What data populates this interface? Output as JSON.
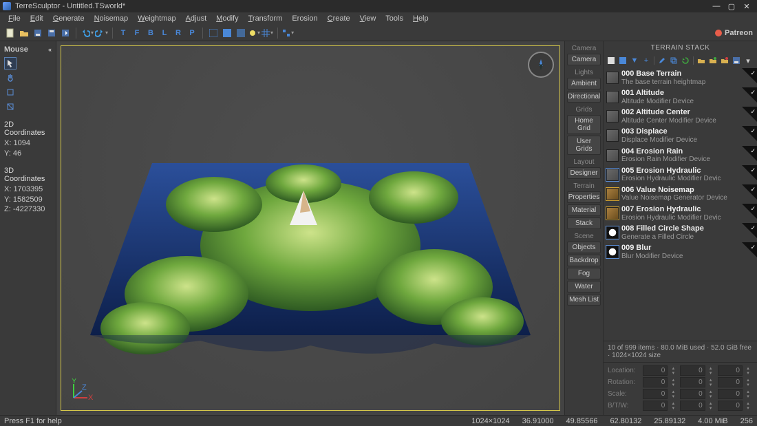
{
  "title": "TerreSculptor - Untitled.TSworld*",
  "window": {
    "min": "—",
    "max": "▢",
    "close": "✕"
  },
  "menus": [
    {
      "u": "F",
      "r": "ile"
    },
    {
      "u": "E",
      "r": "dit"
    },
    {
      "u": "G",
      "r": "enerate"
    },
    {
      "u": "N",
      "r": "oisemap"
    },
    {
      "u": "W",
      "r": "eightmap"
    },
    {
      "u": "A",
      "r": "djust"
    },
    {
      "u": "M",
      "r": "odify"
    },
    {
      "u": "T",
      "r": "ransform"
    },
    {
      "u": "",
      "r": "Erosion"
    },
    {
      "u": "C",
      "r": "reate"
    },
    {
      "u": "V",
      "r": "iew"
    },
    {
      "u": "",
      "r": "Tools"
    },
    {
      "u": "H",
      "r": "elp"
    }
  ],
  "patreon_label": "Patreon",
  "left": {
    "panel_title": "Mouse",
    "coords2d_title": "2D Coordinates",
    "coords2d": {
      "x_label": "X:",
      "x": "1094",
      "y_label": "Y:",
      "y": "46"
    },
    "coords3d_title": "3D Coordinates",
    "coords3d": {
      "x_label": "X:",
      "x": "1703395",
      "y_label": "Y:",
      "y": "1582509",
      "z_label": "Z:",
      "z": "-4227330"
    }
  },
  "categories": [
    {
      "head": "Camera",
      "items": [
        "Camera"
      ]
    },
    {
      "head": "Lights",
      "items": [
        "Ambient",
        "Directional"
      ]
    },
    {
      "head": "Grids",
      "items": [
        "Home Grid",
        "User Grids"
      ]
    },
    {
      "head": "Layout",
      "items": [
        "Designer"
      ]
    },
    {
      "head": "Terrain",
      "items": [
        "Properties",
        "Material",
        "Stack"
      ]
    },
    {
      "head": "Scene",
      "items": [
        "Objects",
        "Backdrop",
        "Fog",
        "Water",
        "Mesh List"
      ]
    }
  ],
  "stack": {
    "title": "TERRAIN STACK",
    "items": [
      {
        "name": "000 Base Terrain",
        "desc": "The base terrain heightmap",
        "thumb": "gray",
        "sel": false
      },
      {
        "name": "001 Altitude",
        "desc": "Altitude Modifier Device",
        "thumb": "gray",
        "sel": false
      },
      {
        "name": "002 Altitude Center",
        "desc": "Altitude Center Modifier Device",
        "thumb": "gray",
        "sel": false
      },
      {
        "name": "003 Displace",
        "desc": "Displace Modifier Device",
        "thumb": "gray",
        "sel": false
      },
      {
        "name": "004 Erosion Rain",
        "desc": "Erosion Rain Modifier Device",
        "thumb": "gray",
        "sel": false
      },
      {
        "name": "005 Erosion Hydraulic",
        "desc": "Erosion Hydraulic Modifier Devic",
        "thumb": "gray",
        "sel": true
      },
      {
        "name": "006 Value Noisemap",
        "desc": "Value Noisemap Generator Device",
        "thumb": "brown",
        "gold": true
      },
      {
        "name": "007 Erosion Hydraulic",
        "desc": "Erosion Hydraulic Modifier Devic",
        "thumb": "brown",
        "gold": true
      },
      {
        "name": "008 Filled Circle Shape",
        "desc": "Generate a Filled Circle",
        "thumb": "circle",
        "sel": true
      },
      {
        "name": "009 Blur",
        "desc": "Blur Modifier Device",
        "thumb": "circle",
        "sel": true
      }
    ],
    "status": "10 of 999 items · 80.0 MiB used · 52.0 GiB free · 1024×1024 size",
    "transform": {
      "rows": [
        "Location:",
        "Rotation:",
        "Scale:",
        "B/T/W:"
      ],
      "location": [
        "0",
        "0",
        "0"
      ],
      "rotation": [
        "0",
        "0",
        "0"
      ],
      "scale": [
        "0",
        "0",
        "0"
      ],
      "btw": [
        "0",
        "0",
        "0"
      ]
    }
  },
  "status": {
    "help": "Press F1 for help",
    "vals": [
      "1024×1024",
      "36.91000",
      "49.85566",
      "62.80132",
      "25.89132",
      "4.00 MiB",
      "256"
    ]
  }
}
